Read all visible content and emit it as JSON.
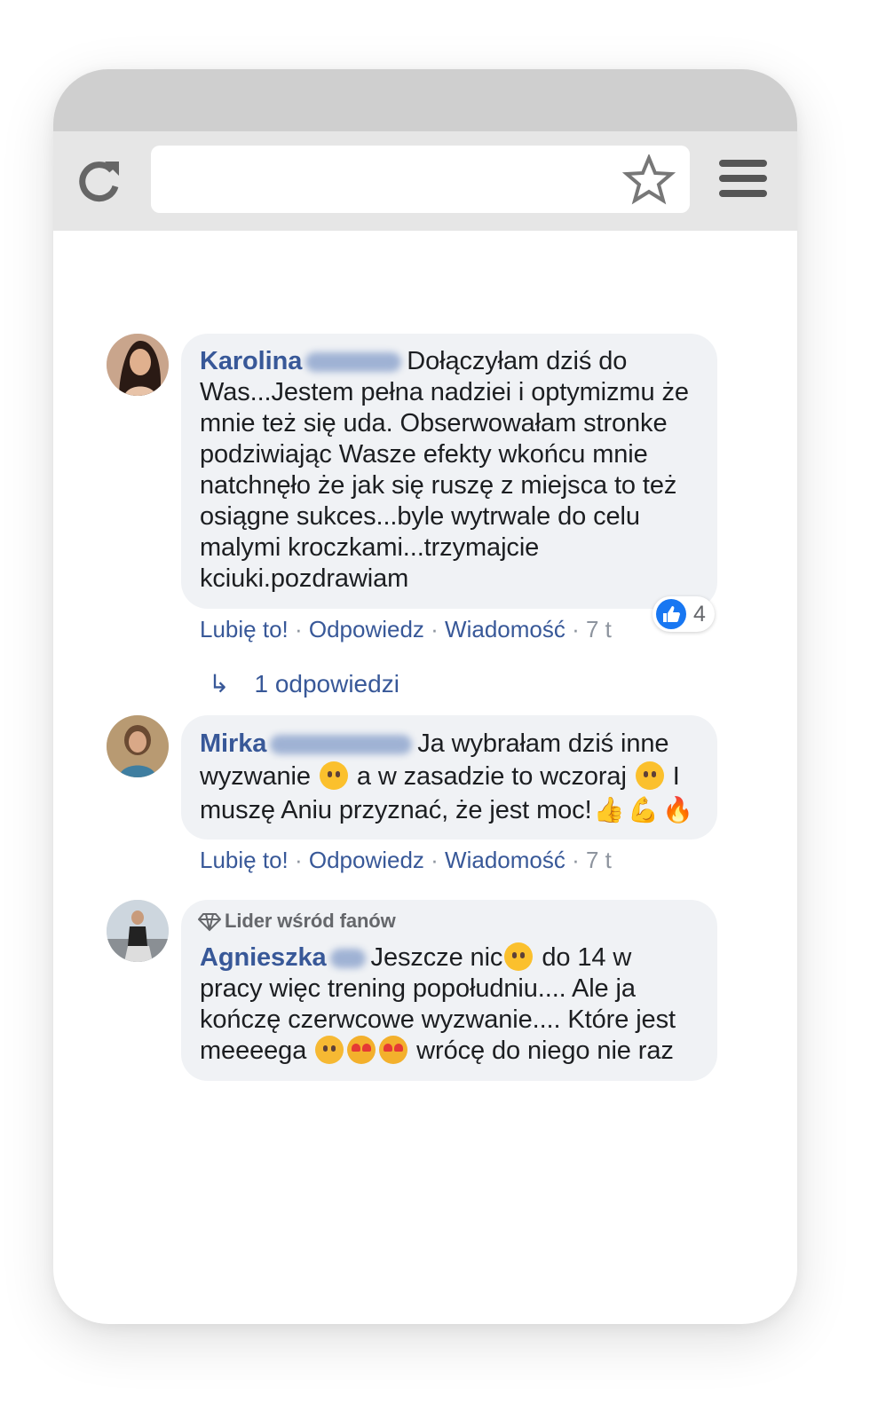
{
  "browser": {
    "reload_icon": "reload-icon",
    "bookmark_icon": "star-icon",
    "menu_icon": "hamburger-menu-icon"
  },
  "comments": [
    {
      "author": "Karolina",
      "text": "Dołączyłam dziś do Was...Jestem pełna nadziei i optymizmu że mnie też się uda. Obserwowałam stronke podziwiając Wasze efekty wkońcu mnie natchnęło że jak się ruszę z miejsca to też osiągne sukces...byle wytrwale do celu malymi kroczkami...trzymajcie kciuki.pozdrawiam",
      "like": "Lubię to!",
      "reply": "Odpowiedz",
      "message": "Wiadomość",
      "time": "7 t",
      "like_count": "4",
      "replies_label": "1 odpowiedzi"
    },
    {
      "author": "Mirka",
      "text_1": "Ja wybrałam dziś inne wyzwanie",
      "text_2": "a w zasadzie to wczoraj",
      "text_3": "I muszę Aniu przyznać, że jest moc!",
      "like": "Lubię to!",
      "reply": "Odpowiedz",
      "message": "Wiadomość",
      "time": "7 t"
    },
    {
      "badge": "Lider wśród fanów",
      "author": "Agnieszka",
      "text_1": "Jeszcze nic",
      "text_2": "do 14 w pracy więc trening popołudniu.... Ale ja kończę czerwcowe wyzwanie.... Które jest meeeega",
      "text_3": "wrócę do niego nie raz"
    }
  ],
  "colors": {
    "link": "#385898",
    "bubble": "#f0f2f5",
    "like_blue": "#1877f2"
  }
}
